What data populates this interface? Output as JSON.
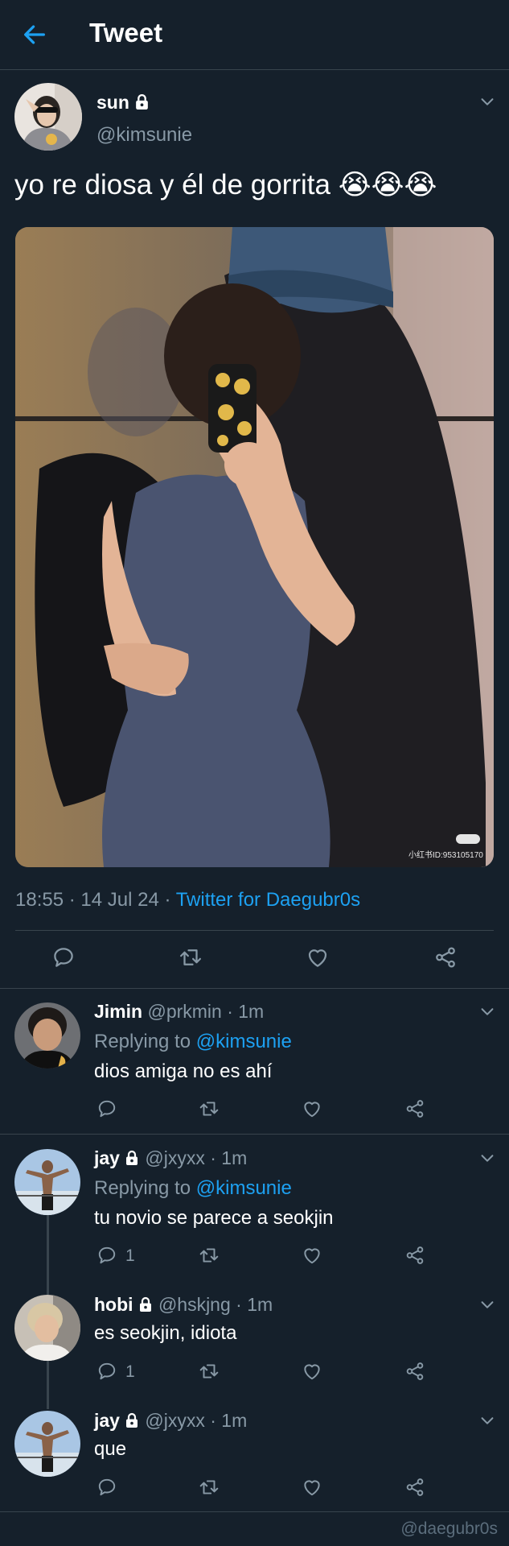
{
  "header": {
    "title": "Tweet"
  },
  "tweet": {
    "author_name": "sun",
    "author_handle": "@kimsunie",
    "text": "yo re diosa y él de gorrita 😭😭😭",
    "timestamp": "18:55 · 14 Jul 24 · ",
    "client": "Twitter for Daegubr0s",
    "media_watermark": "小红书ID:953105170"
  },
  "replies": [
    {
      "name": "Jimin",
      "meta": "@prkmin · 1m",
      "replying_prefix": "Replying to ",
      "replying_to": "@kimsunie",
      "text": "dios amiga no es ahí",
      "reply_count": ""
    },
    {
      "name": "jay",
      "meta": "@jxyxx · 1m",
      "replying_prefix": "Replying to ",
      "replying_to": "@kimsunie",
      "text": "tu novio se parece a seokjin",
      "reply_count": "1"
    },
    {
      "name": "hobi",
      "meta": "@hskjng · 1m",
      "text": "es seokjin, idiota",
      "reply_count": "1"
    },
    {
      "name": "jay",
      "meta": "@jxyxx · 1m",
      "text": "que",
      "reply_count": ""
    }
  ],
  "footer": {
    "watermark": "@daegubr0s"
  },
  "colors": {
    "background": "#15202b",
    "accent": "#1da1f2",
    "muted": "#8899a6",
    "divider": "#38444d"
  }
}
